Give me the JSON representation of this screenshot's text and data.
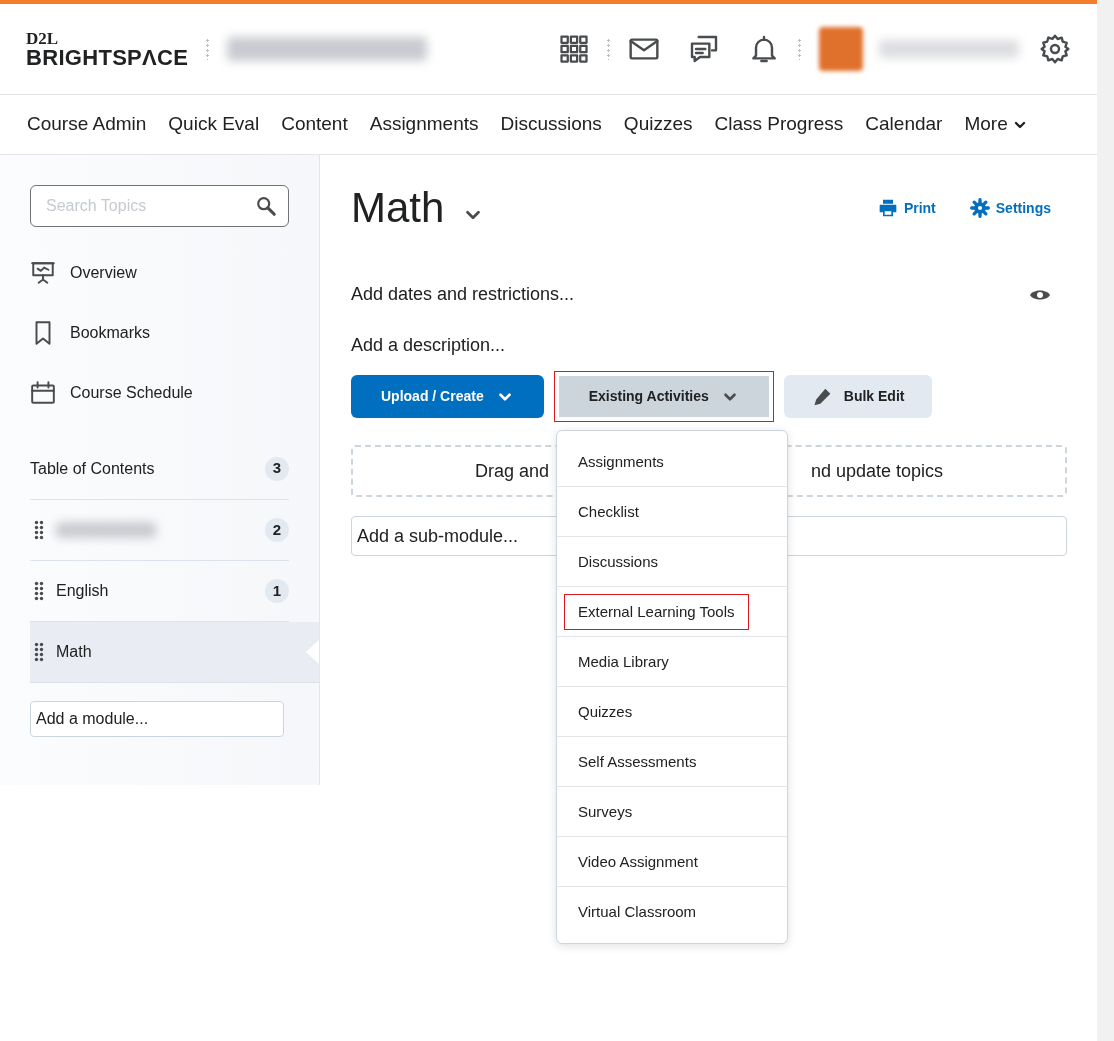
{
  "header": {
    "logo_top": "D2L",
    "logo_bottom": "BRIGHTSPΛCE"
  },
  "nav": [
    {
      "label": "Course Admin"
    },
    {
      "label": "Quick Eval"
    },
    {
      "label": "Content"
    },
    {
      "label": "Assignments"
    },
    {
      "label": "Discussions"
    },
    {
      "label": "Quizzes"
    },
    {
      "label": "Class Progress"
    },
    {
      "label": "Calendar"
    },
    {
      "label": "More",
      "kind": "dropdown"
    }
  ],
  "sidebar": {
    "search": {
      "placeholder": "Search Topics"
    },
    "links": [
      {
        "label": "Overview",
        "kind": "overview"
      },
      {
        "label": "Bookmarks",
        "kind": "bookmark"
      },
      {
        "label": "Course Schedule",
        "kind": "calendar"
      }
    ],
    "toc": {
      "label": "Table of Contents",
      "count": "3"
    },
    "modules": [
      {
        "count": "2",
        "selected": false
      },
      {
        "label": "English",
        "count": "1",
        "selected": false
      },
      {
        "label": "Math",
        "selected": true
      }
    ],
    "add_module": {
      "placeholder": "Add a module..."
    }
  },
  "main": {
    "title": "Math",
    "actions": [
      {
        "label": "Print",
        "kind": "print"
      },
      {
        "label": "Settings",
        "kind": "settings"
      }
    ],
    "dates_link": "Add dates and restrictions...",
    "description_link": "Add a description...",
    "buttons": [
      {
        "label": "Upload / Create",
        "kind": "primary",
        "highlighted": false
      },
      {
        "label": "Existing Activities",
        "kind": "secondary",
        "highlighted": true
      },
      {
        "label": "Bulk Edit",
        "kind": "edit",
        "highlighted": false
      }
    ],
    "drop_zone": {
      "text_left": "Drag and",
      "text_right": "nd update topics"
    },
    "sub_module": {
      "placeholder": "Add a sub-module..."
    },
    "menu": [
      {
        "label": "Assignments",
        "highlighted": false
      },
      {
        "label": "Checklist",
        "highlighted": false
      },
      {
        "label": "Discussions",
        "highlighted": false
      },
      {
        "label": "External Learning Tools",
        "highlighted": true
      },
      {
        "label": "Media Library",
        "highlighted": false
      },
      {
        "label": "Quizzes",
        "highlighted": false
      },
      {
        "label": "Self Assessments",
        "highlighted": false
      },
      {
        "label": "Surveys",
        "highlighted": false
      },
      {
        "label": "Video Assignment",
        "highlighted": false
      },
      {
        "label": "Virtual Classroom",
        "highlighted": false
      }
    ]
  }
}
